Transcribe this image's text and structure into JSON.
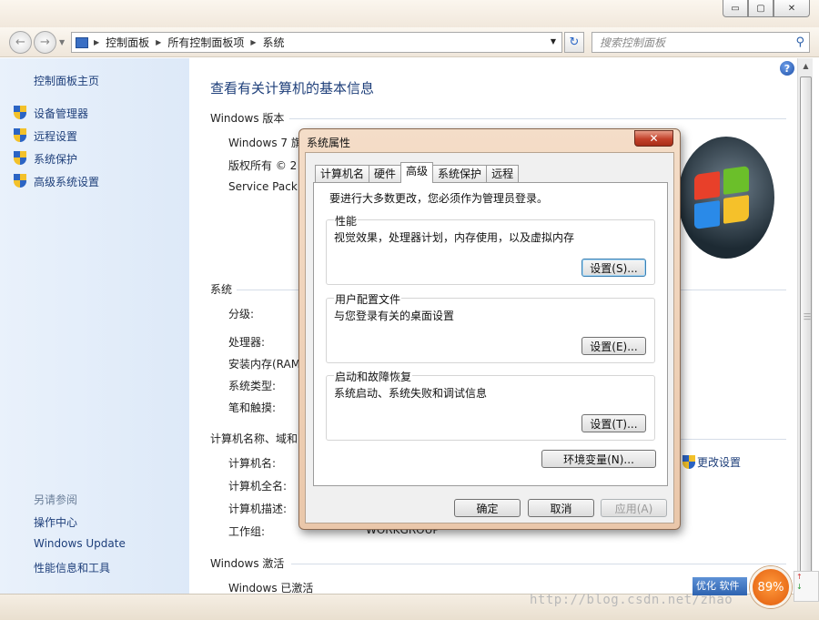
{
  "window": {
    "minimize_glyph": "▭",
    "maximize_glyph": "▢",
    "close_glyph": "✕"
  },
  "nav": {
    "back_glyph": "←",
    "forward_glyph": "→",
    "breadcrumbs": [
      "控制面板",
      "所有控制面板项",
      "系统"
    ],
    "refresh_glyph": "↻",
    "search_placeholder": "搜索控制面板",
    "search_icon": "search-icon"
  },
  "sidebar": {
    "home": "控制面板主页",
    "items": [
      {
        "label": "设备管理器",
        "icon": "uac-shield-icon"
      },
      {
        "label": "远程设置",
        "icon": "uac-shield-icon"
      },
      {
        "label": "系统保护",
        "icon": "uac-shield-icon"
      },
      {
        "label": "高级系统设置",
        "icon": "uac-shield-icon"
      }
    ],
    "see_also": "另请参阅",
    "see_also_items": [
      "操作中心",
      "Windows Update",
      "性能信息和工具"
    ]
  },
  "main": {
    "title": "查看有关计算机的基本信息",
    "edition_section": "Windows 版本",
    "edition_rows": [
      "Windows 7 旗",
      "版权所有 © 2",
      "Service Pack"
    ],
    "system_section": "系统",
    "system_rows": [
      "分级:",
      "处理器:",
      "安装内存(RAM",
      "系统类型:",
      "笔和触摸:"
    ],
    "computer_section": "计算机名称、域和",
    "computer_rows": [
      "计算机名:",
      "计算机全名:",
      "计算机描述:",
      "工作组:"
    ],
    "workgroup_value": "WORKGROUP",
    "change_settings": "更改设置",
    "activation_section": "Windows 激活",
    "activation_row": "Windows 已激活"
  },
  "dialog": {
    "title": "系统属性",
    "close_glyph": "✕",
    "tabs": [
      "计算机名",
      "硬件",
      "高级",
      "系统保护",
      "远程"
    ],
    "active_tab": "高级",
    "intro": "要进行大多数更改，您必须作为管理员登录。",
    "groups": [
      {
        "title": "性能",
        "desc": "视觉效果，处理器计划，内存使用，以及虚拟内存",
        "button": "设置(S)..."
      },
      {
        "title": "用户配置文件",
        "desc": "与您登录有关的桌面设置",
        "button": "设置(E)..."
      },
      {
        "title": "启动和故障恢复",
        "desc": "系统启动、系统失败和调试信息",
        "button": "设置(T)..."
      }
    ],
    "env_button": "环境变量(N)...",
    "ok": "确定",
    "cancel": "取消",
    "apply": "应用(A)"
  },
  "overlay": {
    "watermark": "http://blog.csdn.net/zhao",
    "tray_label": "优化 软件",
    "gauge_value": "89%",
    "net_up": "↑",
    "net_down": "↓"
  },
  "colors": {
    "link": "#1e3f7a",
    "sidebar_bg": "#e3edf9",
    "dialog_frame": "#eccbb0",
    "close_red": "#c3412a"
  }
}
